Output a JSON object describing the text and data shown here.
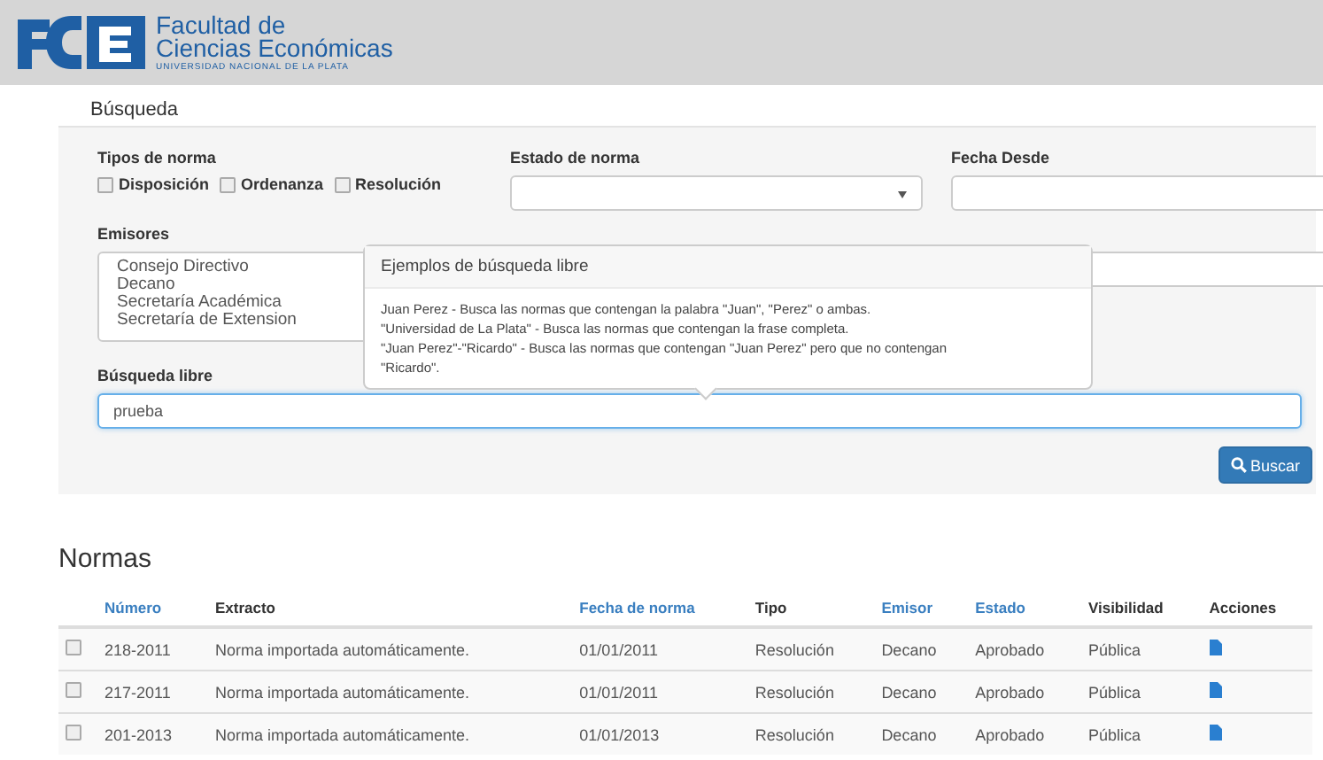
{
  "header": {
    "logo_title_lines": [
      "Facultad de",
      "Ciencias Económicas"
    ],
    "logo_subtitle": "UNIVERSIDAD NACIONAL DE LA PLATA"
  },
  "search": {
    "legend": "Búsqueda",
    "tipos": {
      "label": "Tipos de norma",
      "options": [
        {
          "label": "Disposición",
          "checked": false
        },
        {
          "label": "Ordenanza",
          "checked": false
        },
        {
          "label": "Resolución",
          "checked": false
        }
      ]
    },
    "estado": {
      "label": "Estado de norma"
    },
    "fecha_desde": {
      "label": "Fecha Desde"
    },
    "emisores": {
      "label": "Emisores",
      "items": [
        "Consejo Directivo",
        "Decano",
        "Secretaría Académica",
        "Secretaría de Extension"
      ]
    },
    "libre": {
      "label": "Búsqueda libre",
      "value": "prueba"
    },
    "popover": {
      "title": "Ejemplos de búsqueda libre",
      "lines": [
        "Juan Perez - Busca las normas que contengan la palabra \"Juan\", \"Perez\" o ambas.",
        "\"Universidad de La Plata\" - Busca las normas que contengan la frase completa.",
        "\"Juan Perez\"-\"Ricardo\" - Busca las normas que contengan \"Juan Perez\" pero que no contengan \"Ricardo\"."
      ]
    },
    "button": "Buscar"
  },
  "normas": {
    "title": "Normas",
    "columns": [
      {
        "label": "Número",
        "sortable": true
      },
      {
        "label": "Extracto",
        "sortable": false
      },
      {
        "label": "Fecha de norma",
        "sortable": true
      },
      {
        "label": "Tipo",
        "sortable": false
      },
      {
        "label": "Emisor",
        "sortable": true
      },
      {
        "label": "Estado",
        "sortable": true
      },
      {
        "label": "Visibilidad",
        "sortable": false
      },
      {
        "label": "Acciones",
        "sortable": false
      }
    ],
    "rows": [
      {
        "checked": false,
        "cells": [
          "218-2011",
          "Norma importada automáticamente.",
          "01/01/2011",
          "Resolución",
          "Decano",
          "Aprobado",
          "Pública"
        ]
      },
      {
        "checked": false,
        "cells": [
          "217-2011",
          "Norma importada automáticamente.",
          "01/01/2011",
          "Resolución",
          "Decano",
          "Aprobado",
          "Pública"
        ]
      },
      {
        "checked": false,
        "cells": [
          "201-2013",
          "Norma importada automáticamente.",
          "01/01/2013",
          "Resolución",
          "Decano",
          "Aprobado",
          "Pública"
        ]
      }
    ]
  }
}
